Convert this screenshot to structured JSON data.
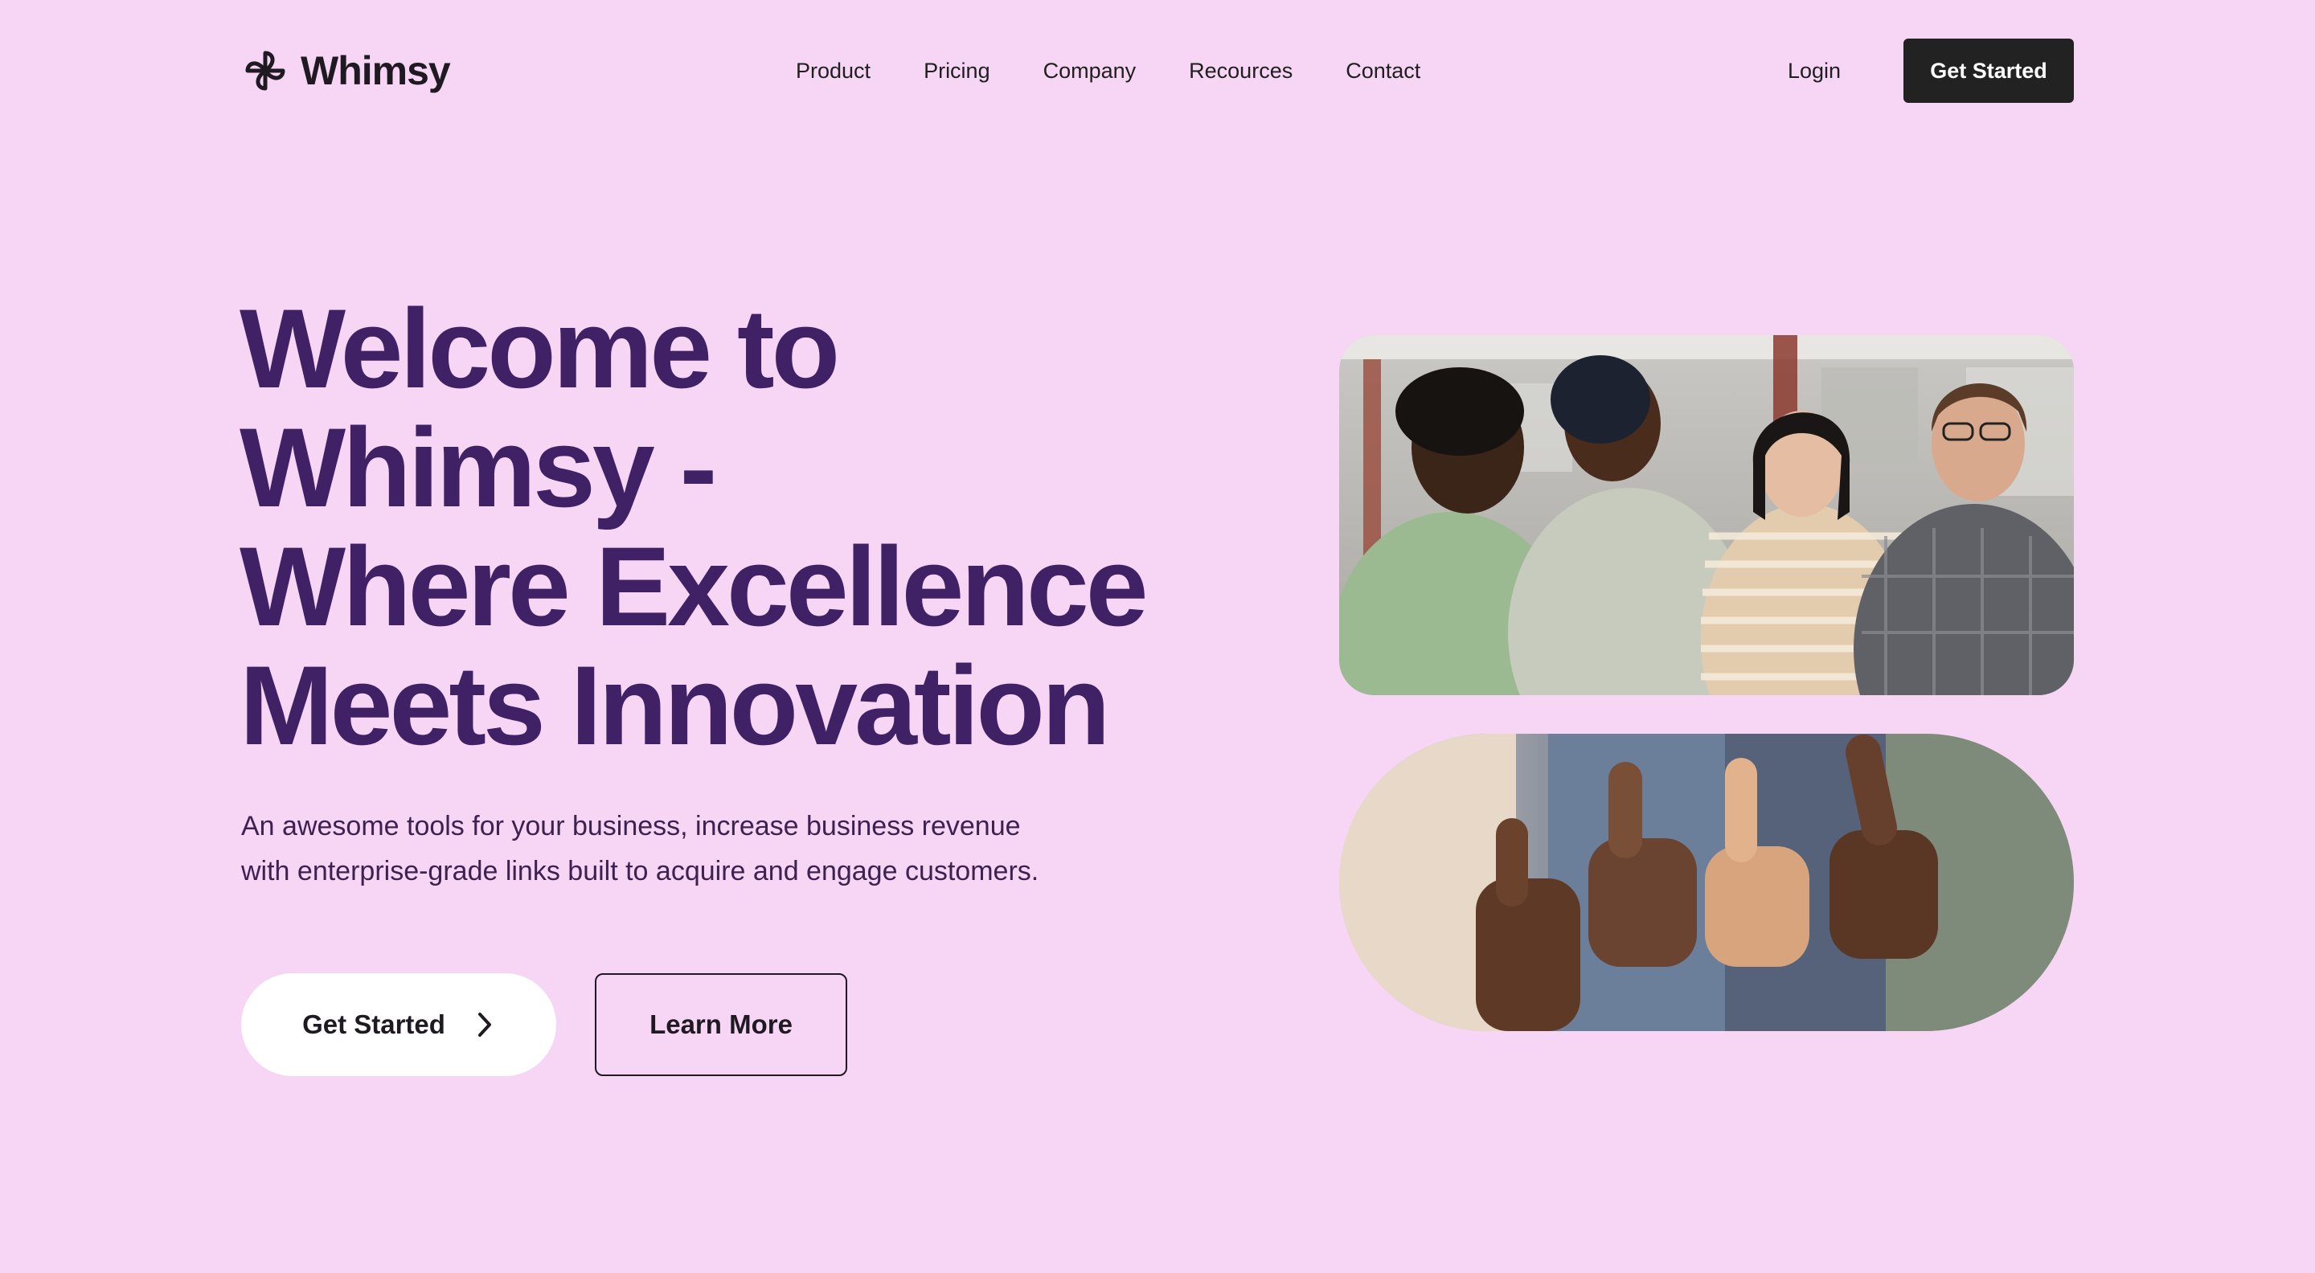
{
  "brand": {
    "name": "Whimsy",
    "logo_icon": "pinwheel-icon"
  },
  "nav": {
    "links": [
      "Product",
      "Pricing",
      "Company",
      "Recources",
      "Contact"
    ],
    "login_label": "Login",
    "cta_label": "Get Started"
  },
  "hero": {
    "title_lines": [
      "Welcome to",
      "Whimsy -",
      "Where Excellence",
      "Meets Innovation"
    ],
    "subtitle_lines": [
      "An awesome tools for your business, increase business revenue",
      "with enterprise-grade links built to acquire and engage customers."
    ],
    "primary_cta": {
      "label": "Get Started",
      "icon": "chevron-right-icon"
    },
    "secondary_cta": {
      "label": "Learn More"
    }
  },
  "colors": {
    "page_background": "#F6D6F4",
    "heading": "#402165",
    "nav_cta_background": "#222222",
    "primary_button_background": "#FFFFFF"
  }
}
